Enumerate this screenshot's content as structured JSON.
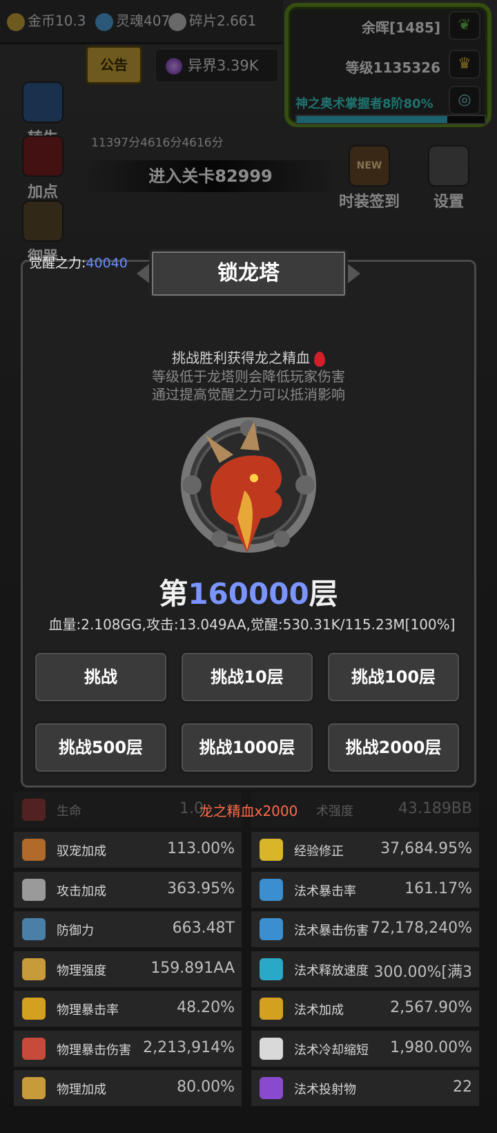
{
  "resources": {
    "gold": "金币10.3",
    "soul": "灵魂407",
    "shards": "碎片2.661",
    "otherworld": "异界3.39K"
  },
  "notice_label": "公告",
  "player": {
    "afterglow": "余晖[1485]",
    "level": "等级1135326",
    "mastery": "神之奥术掌握者8阶80%",
    "mastery_progress": 0.8
  },
  "side_menu": {
    "rebirth": "转生",
    "add_points": "加点",
    "equipment": "御器",
    "outfit_signin": "时装签到",
    "settings": "设置",
    "new_badge": "NEW"
  },
  "scores": "11397分4616分4616分",
  "enter_stage": "进入关卡82999",
  "modal": {
    "title": "锁龙塔",
    "awaken_label": "觉醒之力:",
    "awaken_value": "40040",
    "desc_main": "挑战胜利获得龙之精血",
    "desc_line2": "等级低于龙塔则会降低玩家伤害",
    "desc_line3": "通过提高觉醒之力可以抵消影响",
    "floor_prefix": "第",
    "floor_number": "160000",
    "floor_suffix": "层",
    "stats": "血量:2.108GG,攻击:13.049AA,觉醒:530.31K/115.23M[100%]",
    "buttons": [
      "挑战",
      "挑战10层",
      "挑战100层",
      "挑战500层",
      "挑战1000层",
      "挑战2000层"
    ]
  },
  "reward_text": "龙之精血x2000",
  "stats_top": {
    "left_label": "生命",
    "left_value": "1.0",
    "right_label": "术强度",
    "right_value": "43.189BB"
  },
  "stats": [
    {
      "label": "驭宠加成",
      "value": "113.00%",
      "icon": "paw-icon",
      "color": "#b06a2a"
    },
    {
      "label": "经验修正",
      "value": "37,684.95%",
      "icon": "crown-icon",
      "color": "#d9b52a"
    },
    {
      "label": "攻击加成",
      "value": "363.95%",
      "icon": "swords-icon",
      "color": "#9a9a9a"
    },
    {
      "label": "法术暴击率",
      "value": "161.17%",
      "icon": "spell-crit-icon",
      "color": "#3b8fd0"
    },
    {
      "label": "防御力",
      "value": "663.48T",
      "icon": "shield-icon",
      "color": "#4a7fa8"
    },
    {
      "label": "法术暴击伤害",
      "value": "72,178,240%",
      "icon": "spell-damage-icon",
      "color": "#3b8fd0"
    },
    {
      "label": "物理强度",
      "value": "159.891AA",
      "icon": "sword-icon",
      "color": "#c89b3a"
    },
    {
      "label": "法术释放速度",
      "value": "300.00%[满3",
      "icon": "mushroom-icon",
      "color": "#2aa8c8"
    },
    {
      "label": "物理暴击率",
      "value": "48.20%",
      "icon": "phys-crit-icon",
      "color": "#d4a020"
    },
    {
      "label": "法术加成",
      "value": "2,567.90%",
      "icon": "spell-bonus-icon",
      "color": "#d4a020"
    },
    {
      "label": "物理暴击伤害",
      "value": "2,213,914%",
      "icon": "phys-damage-icon",
      "color": "#c84a3a"
    },
    {
      "label": "法术冷却缩短",
      "value": "1,980.00%",
      "icon": "hourglass-icon",
      "color": "#d9d9d9"
    },
    {
      "label": "物理加成",
      "value": "80.00%",
      "icon": "phys-bonus-icon",
      "color": "#c89b3a"
    },
    {
      "label": "法术投射物",
      "value": "22",
      "icon": "projectile-icon",
      "color": "#8a4ad0"
    }
  ]
}
